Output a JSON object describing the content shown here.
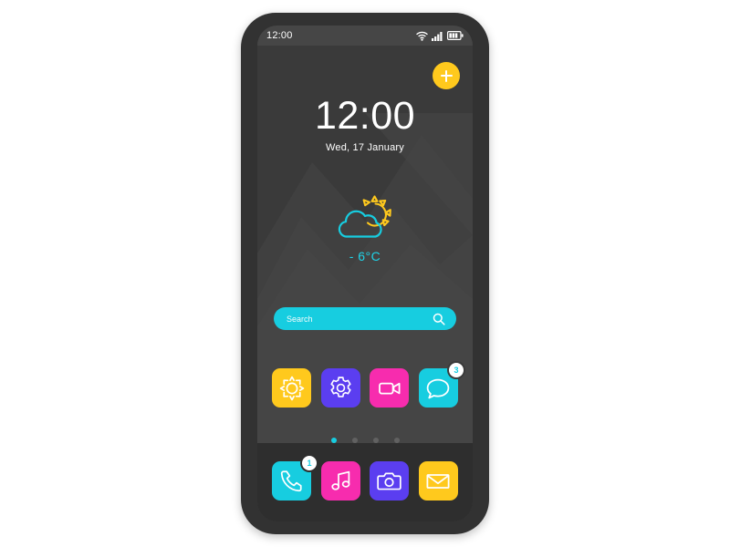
{
  "device": {
    "name": "smartphone-mockup",
    "frame_color": "#323232",
    "screen_bg": "#3a3a3a",
    "dock_bg": "#2e2e2e"
  },
  "palette": {
    "yellow": "#ffc91d",
    "purple": "#5b3ef0",
    "pink": "#f72cae",
    "cyan": "#17cde0",
    "white": "#ffffff",
    "dot_inactive": "#616161"
  },
  "status_bar": {
    "time": "12:00",
    "icons": [
      {
        "name": "wifi-icon",
        "label": "wifi"
      },
      {
        "name": "cellular-signal-icon",
        "label": "signal",
        "bars": 4
      },
      {
        "name": "battery-icon",
        "label": "battery",
        "segments": 3
      }
    ]
  },
  "fab": {
    "icon": "plus-icon",
    "label": "+",
    "color": "#ffc91d"
  },
  "clock": {
    "time": "12:00",
    "date": "Wed, 17 January"
  },
  "weather": {
    "icon": "cloud-sun-icon",
    "temperature": "- 6°C",
    "cloud_color": "#17cde0",
    "sun_color": "#ffc91d"
  },
  "search": {
    "placeholder": "Search",
    "value": "",
    "icon": "search-icon",
    "background": "#17cde0"
  },
  "app_grid": [
    {
      "name": "brightness",
      "icon": "sun-icon",
      "color": "#ffc91d",
      "badge": null
    },
    {
      "name": "settings",
      "icon": "gear-icon",
      "color": "#5b3ef0",
      "badge": null
    },
    {
      "name": "video",
      "icon": "video-camera-icon",
      "color": "#f72cae",
      "badge": null
    },
    {
      "name": "messages",
      "icon": "chat-bubble-icon",
      "color": "#17cde0",
      "badge": "3"
    }
  ],
  "page_indicator": {
    "total": 4,
    "active_index": 0
  },
  "dock": [
    {
      "name": "phone",
      "icon": "phone-icon",
      "color": "#17cde0",
      "badge": "1"
    },
    {
      "name": "music",
      "icon": "music-note-icon",
      "color": "#f72cae",
      "badge": null
    },
    {
      "name": "camera",
      "icon": "camera-icon",
      "color": "#5b3ef0",
      "badge": null
    },
    {
      "name": "mail",
      "icon": "envelope-icon",
      "color": "#ffc91d",
      "badge": null
    }
  ]
}
